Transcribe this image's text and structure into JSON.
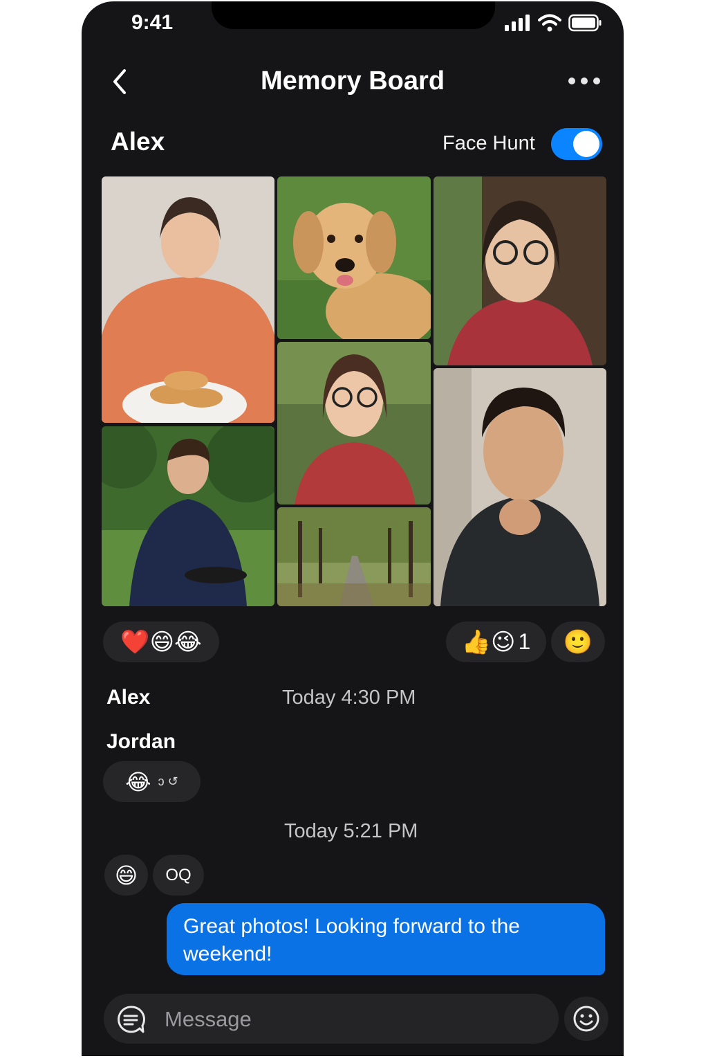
{
  "status_bar": {
    "time": "9:41"
  },
  "nav": {
    "title": "Memory Board"
  },
  "board": {
    "owner": "Alex",
    "toggle_label": "Face Hunt",
    "toggle_on": true
  },
  "reactions_left": {
    "emojis": "❤️😄😂"
  },
  "reactions_right": {
    "emojis": "👍😉",
    "count": "1",
    "add_emoji": "🙂"
  },
  "messages": [
    {
      "sender": "Alex",
      "time": "Today 4:30 PM"
    },
    {
      "sender": "Jordan",
      "reaction": "😂",
      "reaction_marks": "ↄ ↺"
    },
    {
      "time": "Today 5:21 PM"
    },
    {
      "reaction": "😄",
      "text": "OQ"
    },
    {
      "text": "Great photos! Looking forward to the weekend!"
    }
  ],
  "composer": {
    "placeholder": "Message"
  },
  "colors": {
    "accent": "#0a84ff",
    "bubble": "#0a72e5",
    "background": "#151517"
  }
}
